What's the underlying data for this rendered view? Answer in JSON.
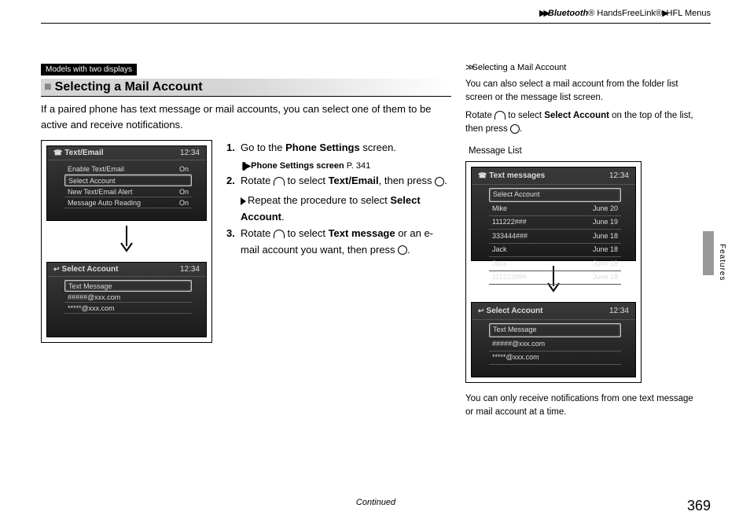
{
  "breadcrumb": {
    "bt": "Bluetooth",
    "reg1": "®",
    "hfl": " HandsFreeLink",
    "reg2": "®",
    "menus": "HFL Menus"
  },
  "tag": "Models with two displays",
  "section_title": "Selecting a Mail Account",
  "intro": "If a paired phone has text message or mail accounts, you can select one of them to be active and receive notifications.",
  "steps": {
    "s1a": "Go to the ",
    "s1b": "Phone Settings",
    "s1c": " screen.",
    "ref_label": "Phone Settings screen",
    "ref_page": "P. 341",
    "s2a": "Rotate ",
    "s2b": " to select ",
    "s2c": "Text/Email",
    "s2d": ", then press ",
    "s2e": ".",
    "s2_repeat_a": "Repeat the procedure to select ",
    "s2_repeat_b": "Select Account",
    "s2_repeat_c": ".",
    "s3a": "Rotate ",
    "s3b": " to select ",
    "s3c": "Text message",
    "s3d": " or an e-mail account you want, then press ",
    "s3e": "."
  },
  "screenA": {
    "title": "Text/Email",
    "time": "12:34",
    "rows": [
      {
        "l": "Enable Text/Email",
        "r": "On"
      },
      {
        "l": "Select Account",
        "r": ""
      },
      {
        "l": "New Text/Email Alert",
        "r": "On"
      },
      {
        "l": "Message Auto Reading",
        "r": "On"
      }
    ],
    "sel_index": 1
  },
  "screenB": {
    "title": "Select Account",
    "time": "12:34",
    "rows": [
      {
        "l": "Text Message",
        "r": ""
      },
      {
        "l": "#####@xxx.com",
        "r": ""
      },
      {
        "l": "*****@xxx.com",
        "r": ""
      }
    ],
    "sel_index": 0
  },
  "side": {
    "head": "Selecting a Mail Account",
    "p1": "You can also select a mail account from the folder list screen or the message list screen.",
    "p2a": "Rotate ",
    "p2b": " to select ",
    "p2c": "Select Account",
    "p2d": " on the top of the list, then press ",
    "p2e": ".",
    "msg_label": "Message List",
    "p3": "You can only receive notifications from one text message or mail account at a time."
  },
  "screenC": {
    "title": "Text messages",
    "time": "12:34",
    "rows": [
      {
        "l": "Select Account",
        "r": ""
      },
      {
        "l": "Mike",
        "r": "June 20"
      },
      {
        "l": "111222###",
        "r": "June 19"
      },
      {
        "l": "333444###",
        "r": "June 18"
      },
      {
        "l": "Jack",
        "r": "June 18"
      },
      {
        "l": "Jack",
        "r": "June 18"
      },
      {
        "l": "111222###",
        "r": "June 18"
      }
    ],
    "sel_index": 0
  },
  "screenD": {
    "title": "Select Account",
    "time": "12:34",
    "rows": [
      {
        "l": "Text Message",
        "r": ""
      },
      {
        "l": "#####@xxx.com",
        "r": ""
      },
      {
        "l": "*****@xxx.com",
        "r": ""
      }
    ],
    "sel_index": 0
  },
  "side_tab": "Features",
  "continued": "Continued",
  "pageno": "369"
}
